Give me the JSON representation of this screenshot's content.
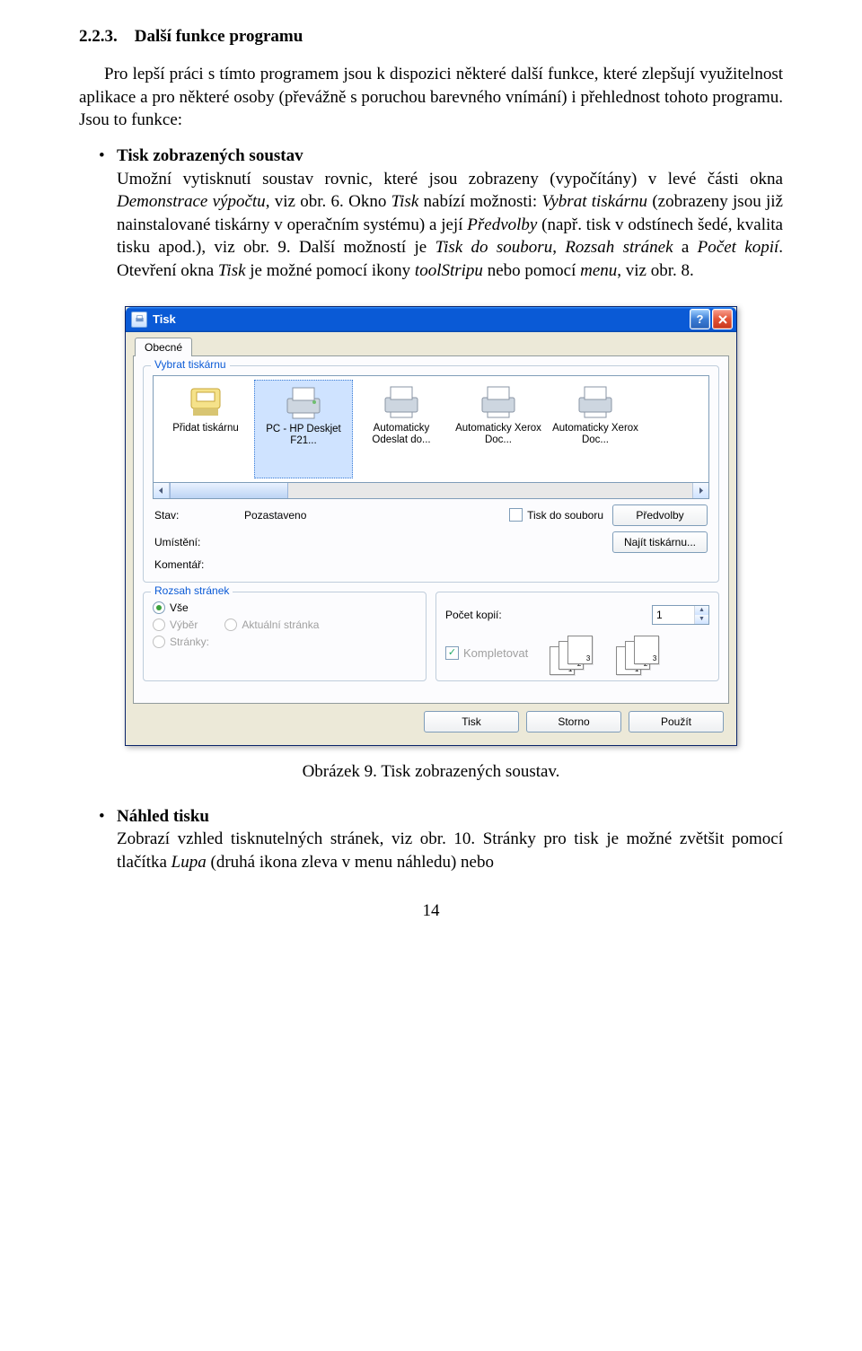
{
  "heading_num": "2.2.3.",
  "heading_title": "Další funkce programu",
  "intro": "Pro lepší práci s tímto programem jsou k dispozici některé další funkce, které zlepšují využitelnost aplikace a pro některé osoby (převážně s poruchou barevného vnímání) i přehlednost tohoto programu. Jsou to funkce:",
  "bullet1": {
    "title": "Tisk zobrazených soustav",
    "p1a": "Umožní vytisknutí soustav rovnic, které jsou zobrazeny (vypočítány) v levé části okna ",
    "p1b_i": "Demonstrace výpočtu",
    "p1c": ", viz obr. 6. Okno ",
    "p1d_i": "Tisk",
    "p1e": " nabízí možnosti: ",
    "p1f_i": "Vybrat tiskárnu",
    "p1g": " (zobrazeny jsou již nainstalované tiskárny v operačním systému) a její ",
    "p1h_i": "Předvolby",
    "p1i": " (např. tisk v odstínech šedé, kvalita tisku apod.), viz obr. 9. Další možností je ",
    "p1j_i": "Tisk do souboru",
    "p1k": ", ",
    "p1l_i": "Rozsah stránek",
    "p1m": " a ",
    "p1n_i": "Počet kopií",
    "p1o": ". Otevření okna ",
    "p1p_i": "Tisk",
    "p1q": " je možné pomocí ikony ",
    "p1r_i": "toolStripu",
    "p1s": " nebo pomocí ",
    "p1t_i": "menu",
    "p1u": ", viz obr. 8."
  },
  "dialog": {
    "title": "Tisk",
    "tab": "Obecné",
    "group_printer": "Vybrat tiskárnu",
    "printers": [
      {
        "label": "Přidat tiskárnu"
      },
      {
        "label": "PC - HP Deskjet F21..."
      },
      {
        "label": "Automaticky Odeslat do..."
      },
      {
        "label": "Automaticky Xerox Doc..."
      },
      {
        "label": "Automaticky Xerox Doc..."
      }
    ],
    "stav_label": "Stav:",
    "stav_value": "Pozastaveno",
    "umisteni_label": "Umístění:",
    "komentar_label": "Komentář:",
    "tisk_souboru": "Tisk do souboru",
    "predvolby_btn": "Předvolby",
    "najit_btn": "Najít tiskárnu...",
    "group_range": "Rozsah stránek",
    "r_vse": "Vše",
    "r_vyber": "Výběr",
    "r_aktualni": "Aktuální stránka",
    "r_stranky": "Stránky:",
    "copies_label": "Počet kopií:",
    "copies_value": "1",
    "kompletovat": "Kompletovat",
    "btn_tisk": "Tisk",
    "btn_storno": "Storno",
    "btn_pouzit": "Použít"
  },
  "figure_caption": "Obrázek 9. Tisk zobrazených soustav.",
  "bullet2": {
    "title": "Náhled tisku",
    "text_a": "Zobrazí vzhled tisknutelných stránek, viz obr. 10. Stránky pro tisk je možné zvětšit pomocí tlačítka ",
    "text_b_i": "Lupa",
    "text_c": " (druhá ikona zleva v menu náhledu) nebo"
  },
  "page_num": "14"
}
